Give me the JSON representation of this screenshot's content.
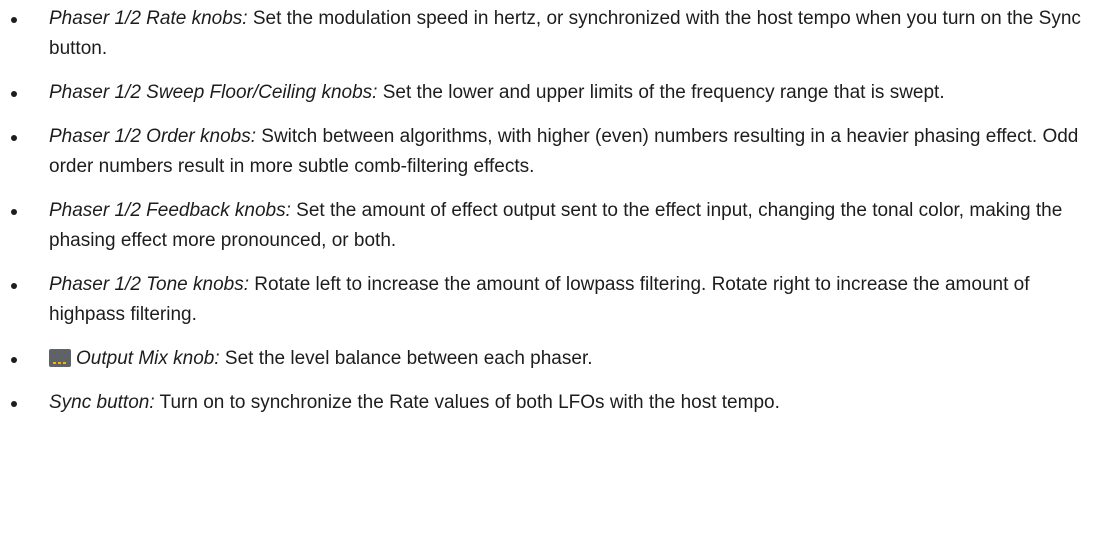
{
  "bullets": [
    {
      "term": "Phaser 1/2 Rate knobs:",
      "text": " Set the modulation speed in hertz, or synchronized with the host tempo when you turn on the Sync button."
    },
    {
      "term": "Phaser 1/2 Sweep Floor/Ceiling knobs:",
      "text": " Set the lower and upper limits of the frequency range that is swept."
    },
    {
      "term": "Phaser 1/2 Order knobs:",
      "text": " Switch between algorithms, with higher (even) numbers resulting in a heavier phasing effect. Odd order numbers result in more subtle comb-filtering effects."
    },
    {
      "term": "Phaser 1/2 Feedback knobs:",
      "text": " Set the amount of effect output sent to the effect input, changing the tonal color, making the phasing effect more pronounced, or both."
    },
    {
      "term": "Phaser 1/2 Tone knobs:",
      "text": " Rotate left to increase the amount of lowpass filtering. Rotate right to increase the amount of highpass filtering."
    },
    {
      "icon": "knob-icon",
      "term": "Output Mix knob:",
      "text": " Set the level balance between each phaser."
    },
    {
      "term": "Sync button:",
      "text": " Turn on to synchronize the Rate values of both LFOs with the host tempo."
    }
  ]
}
